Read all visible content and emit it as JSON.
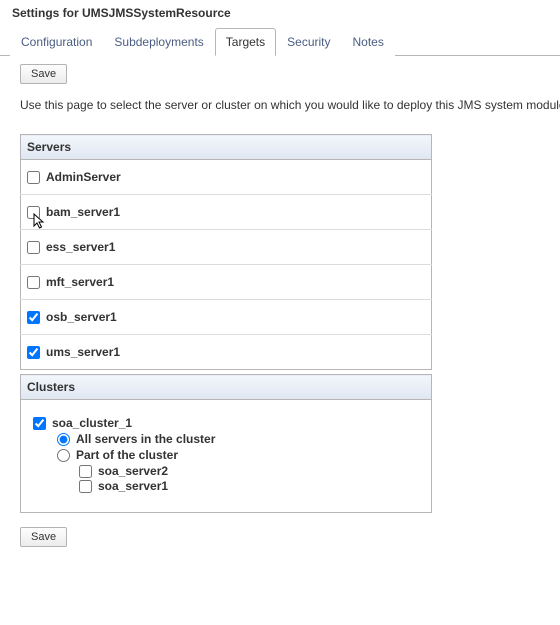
{
  "title": "Settings for UMSJMSSystemResource",
  "tabs": [
    {
      "label": "Configuration",
      "active": false
    },
    {
      "label": "Subdeployments",
      "active": false
    },
    {
      "label": "Targets",
      "active": true
    },
    {
      "label": "Security",
      "active": false
    },
    {
      "label": "Notes",
      "active": false
    }
  ],
  "buttons": {
    "save": "Save"
  },
  "help_text": "Use this page to select the server or cluster on which you would like to deploy this JMS system module. You can",
  "servers_heading": "Servers",
  "servers": [
    {
      "name": "AdminServer",
      "checked": false,
      "cursor": false
    },
    {
      "name": "bam_server1",
      "checked": false,
      "cursor": true
    },
    {
      "name": "ess_server1",
      "checked": false,
      "cursor": false
    },
    {
      "name": "mft_server1",
      "checked": false,
      "cursor": false
    },
    {
      "name": "osb_server1",
      "checked": true,
      "cursor": false
    },
    {
      "name": "ums_server1",
      "checked": true,
      "cursor": false
    }
  ],
  "clusters_heading": "Clusters",
  "clusters": [
    {
      "name": "soa_cluster_1",
      "checked": true,
      "options": {
        "all_label": "All servers in the cluster",
        "part_label": "Part of the cluster",
        "selected": "all"
      },
      "members": [
        {
          "name": "soa_server2",
          "checked": false
        },
        {
          "name": "soa_server1",
          "checked": false
        }
      ]
    }
  ]
}
